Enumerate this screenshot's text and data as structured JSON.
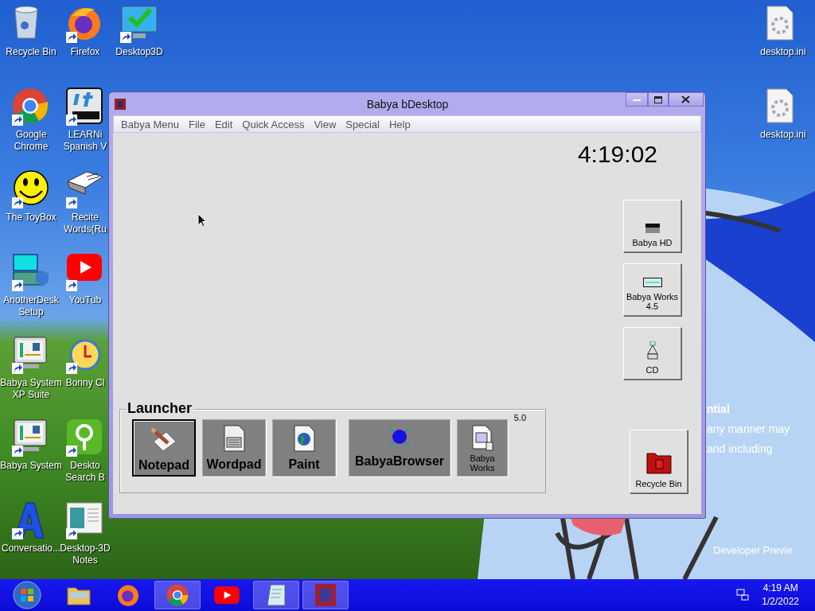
{
  "desktop_columns": [
    [
      {
        "lines": [
          "Recycle Bin"
        ],
        "kind": "recycle",
        "shortcut": false
      },
      {
        "lines": [
          "Google",
          "Chrome"
        ],
        "kind": "chrome",
        "shortcut": true
      },
      {
        "lines": [
          "The ToyBox"
        ],
        "kind": "smiley",
        "shortcut": true
      },
      {
        "lines": [
          "AnotherDesk",
          "Setup"
        ],
        "kind": "anotherdesk",
        "shortcut": true
      },
      {
        "lines": [
          "Babya System",
          "XP Suite"
        ],
        "kind": "monitor",
        "shortcut": true
      },
      {
        "lines": [
          "Babya System"
        ],
        "kind": "monitor",
        "shortcut": true
      },
      {
        "lines": [
          "Conversatio..."
        ],
        "kind": "letter",
        "shortcut": true
      }
    ],
    [
      {
        "lines": [
          "Firefox"
        ],
        "kind": "firefox",
        "shortcut": true
      },
      {
        "lines": [
          "LEARNi",
          "Spanish V"
        ],
        "kind": "learn",
        "shortcut": true
      },
      {
        "lines": [
          "Recite",
          "Words(Ru"
        ],
        "kind": "book",
        "shortcut": true
      },
      {
        "lines": [
          "YouTub"
        ],
        "kind": "youtube",
        "shortcut": true
      },
      {
        "lines": [
          "Bonny Cl"
        ],
        "kind": "clock",
        "shortcut": true
      },
      {
        "lines": [
          "Deskto",
          "Search B"
        ],
        "kind": "search",
        "shortcut": true
      },
      {
        "lines": [
          "Desktop-3D",
          "Notes"
        ],
        "kind": "notes",
        "shortcut": true
      }
    ],
    [
      {
        "lines": [
          "Desktop3D"
        ],
        "kind": "check",
        "shortcut": true
      }
    ]
  ],
  "desktop_right": [
    {
      "lines": [
        "desktop.ini"
      ],
      "kind": "ini",
      "shortcut": false
    },
    {
      "lines": [
        "desktop.ini"
      ],
      "kind": "ini",
      "shortcut": false
    }
  ],
  "wallpaper_text": [
    "ntial",
    "any manner may",
    "and including"
  ],
  "wallpaper_footer": "Developer Previe",
  "window": {
    "title": "Babya bDesktop",
    "menu": [
      "Babya Menu",
      "File",
      "Edit",
      "Quick Access",
      "View",
      "Special",
      "Help"
    ],
    "clock": "4:19:02",
    "drives": [
      {
        "label": [
          "Babya HD"
        ],
        "kind": "hd"
      },
      {
        "label": [
          "Babya Works",
          "4.5"
        ],
        "kind": "works"
      },
      {
        "label": [
          "CD"
        ],
        "kind": "cd"
      }
    ],
    "recycle_bin": "Recycle Bin",
    "launcher": {
      "title": "Launcher",
      "version": "5.0",
      "items": [
        {
          "label": "Notepad",
          "kind": "notepad",
          "selected": true
        },
        {
          "label": "Wordpad",
          "kind": "wordpad",
          "selected": false
        },
        {
          "label": "Paint",
          "kind": "paint",
          "selected": false
        },
        {
          "label": "BabyaBrowser",
          "kind": "browser",
          "selected": false
        },
        {
          "label": "Babya Works",
          "kind": "works",
          "selected": false
        }
      ]
    }
  },
  "taskbar": {
    "items": [
      {
        "kind": "folder",
        "running": false
      },
      {
        "kind": "firefox",
        "running": false
      },
      {
        "kind": "chrome",
        "running": true
      },
      {
        "kind": "youtube",
        "running": false
      },
      {
        "kind": "notepad",
        "running": true
      },
      {
        "kind": "babya",
        "running": true
      }
    ],
    "time": "4:19 AM",
    "date": "1/2/2022"
  }
}
